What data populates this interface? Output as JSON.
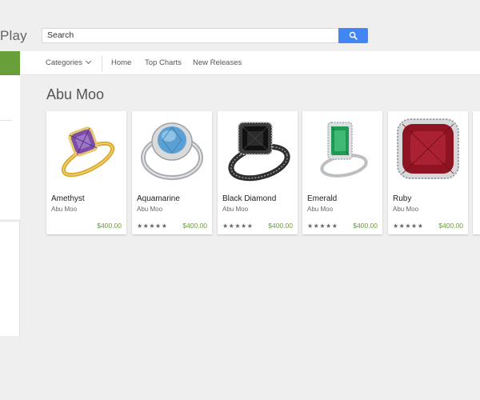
{
  "header": {
    "logo": "Play",
    "search_value": "Search"
  },
  "nav": {
    "categories": "Categories",
    "home": "Home",
    "top_charts": "Top Charts",
    "new_releases": "New Releases"
  },
  "page": {
    "title": "Abu Moo"
  },
  "colors": {
    "accent": "#689f38",
    "search_button": "#4285f4",
    "price": "#689f38"
  },
  "products": [
    {
      "title": "Amethyst",
      "seller": "Abu Moo",
      "price": "$400.00",
      "stars": "",
      "stone_color": "#7d4ea8"
    },
    {
      "title": "Aquamarine",
      "seller": "Abu Moo",
      "price": "$400.00",
      "stars": "★★★★★",
      "stone_color": "#5aa0d2"
    },
    {
      "title": "Black Diamond",
      "seller": "Abu Moo",
      "price": "$400.00",
      "stars": "★★★★★",
      "stone_color": "#1a1a1a"
    },
    {
      "title": "Emerald",
      "seller": "Abu Moo",
      "price": "$400.00",
      "stars": "★★★★★",
      "stone_color": "#1f9a55"
    },
    {
      "title": "Ruby",
      "seller": "Abu Moo",
      "price": "$400.00",
      "stars": "★★★★★",
      "stone_color": "#8e1424"
    }
  ]
}
